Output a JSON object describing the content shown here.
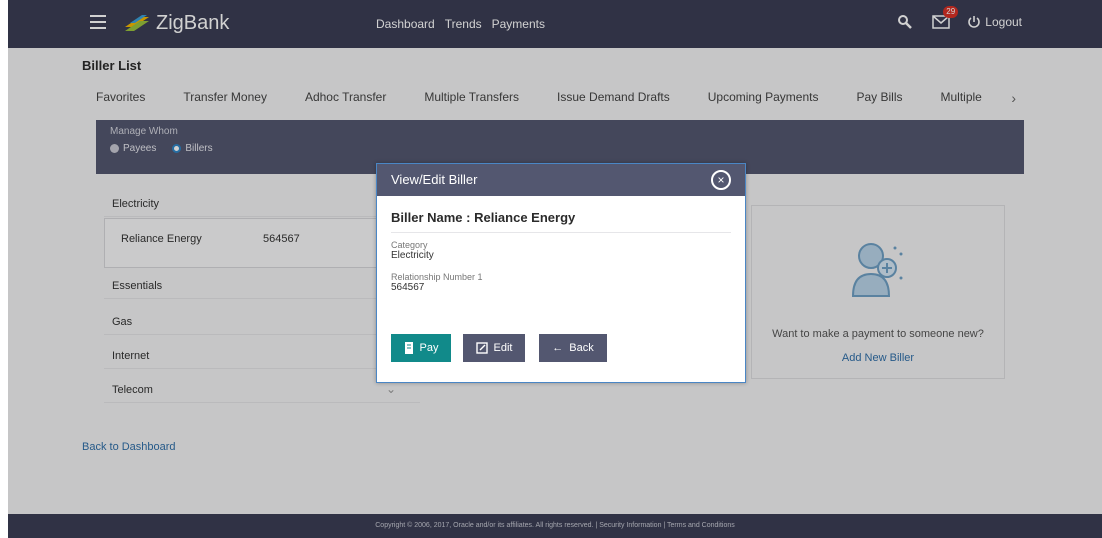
{
  "header": {
    "app_name": "ZigBank",
    "nav": [
      "Dashboard",
      "Trends",
      "Payments"
    ],
    "notification_count": "29",
    "logout_label": "Logout",
    "bg_color": "#3b3e55"
  },
  "page": {
    "title": "Biller List",
    "tabs": [
      "Favorites",
      "Transfer Money",
      "Adhoc Transfer",
      "Multiple Transfers",
      "Issue Demand Drafts",
      "Upcoming Payments",
      "Pay Bills",
      "Multiple"
    ],
    "manage_whom_label": "Manage Whom",
    "radio_options": [
      {
        "label": "Payees",
        "selected": false
      },
      {
        "label": "Billers",
        "selected": true
      }
    ],
    "categories": [
      "Electricity",
      "Essentials",
      "Gas",
      "Internet",
      "Telecom"
    ],
    "biller_row": {
      "name": "Reliance Energy",
      "relationship": "564567"
    },
    "new_biller_prompt": "Want to make a payment to someone new?",
    "add_new_biller": "Add New Biller",
    "back_to_dashboard": "Back to Dashboard",
    "footer": "Copyright © 2006, 2017, Oracle and/or its affiliates. All rights reserved. | Security Information | Terms and Conditions"
  },
  "modal": {
    "title": "View/Edit Biller",
    "biller_name": "Biller Name : Reliance Energy",
    "category_label": "Category",
    "category_value": "Electricity",
    "relationship_label": "Relationship Number 1",
    "relationship_value": "564567",
    "buttons": {
      "pay": "Pay",
      "edit": "Edit",
      "back": "Back"
    },
    "pay_color": "#118a8a",
    "secondary_color": "#535770"
  }
}
